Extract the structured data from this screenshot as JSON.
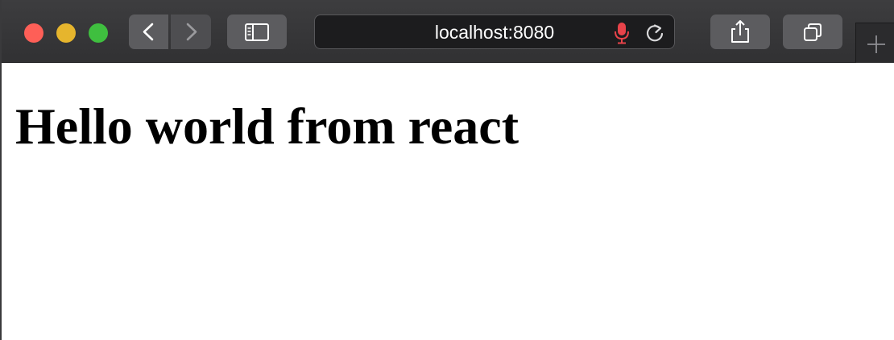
{
  "browser": {
    "address_bar": {
      "url": "localhost:8080"
    },
    "window_controls": [
      "close",
      "minimize",
      "maximize"
    ],
    "toolbar_icons": {
      "back": "chevron-left-icon",
      "forward": "chevron-right-icon",
      "sidebar": "sidebar-icon",
      "microphone": "microphone-icon",
      "reload": "reload-icon",
      "share": "share-icon",
      "tabs": "tabs-overview-icon",
      "new_tab": "plus-icon"
    },
    "colors": {
      "toolbar": "#353537",
      "close": "#fe5f57",
      "minimize": "#e6b52d",
      "maximize": "#3fbf3f",
      "mic": "#e8434a"
    }
  },
  "page": {
    "heading": "Hello world from react"
  }
}
